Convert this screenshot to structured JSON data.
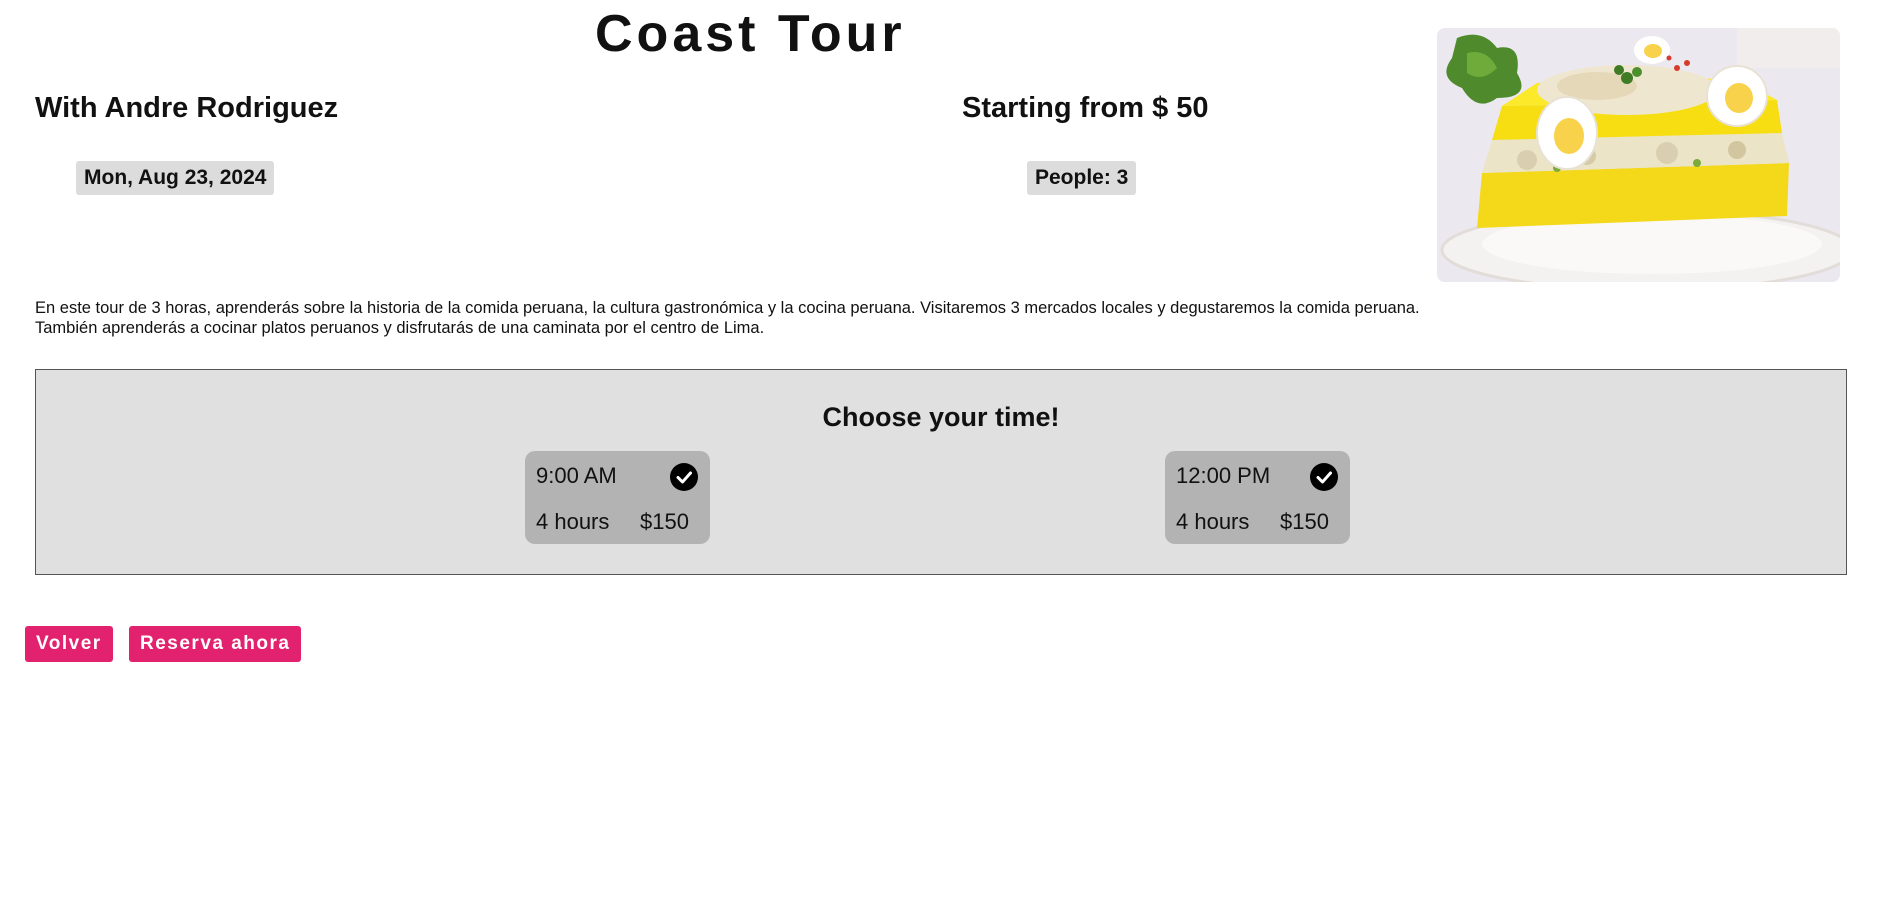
{
  "tour": {
    "title": "Coast Tour",
    "guide": "With Andre Rodriguez",
    "starting_price": "Starting from $ 50",
    "date": "Mon, Aug 23, 2024",
    "people": "People: 3",
    "description": "En este tour de 3 horas, aprenderás sobre la historia de la comida peruana, la cultura gastronómica y la cocina peruana. Visitaremos 3 mercados locales y degustaremos la comida peruana. También aprenderás a cocinar platos peruanos y disfrutarás de una caminata por el centro de Lima.",
    "image": {
      "alt": "causa-dish-photo"
    }
  },
  "time_picker": {
    "heading": "Choose your time!",
    "slots": [
      {
        "time": "9:00 AM",
        "duration": "4 hours",
        "price": "$150",
        "icon": "check-circle-icon"
      },
      {
        "time": "12:00 PM",
        "duration": "4 hours",
        "price": "$150",
        "icon": "check-circle-icon"
      }
    ]
  },
  "actions": {
    "back_label": "Volver",
    "book_label": "Reserva ahora"
  },
  "colors": {
    "accent": "#e3226f",
    "panel_bg": "#e0e0e0",
    "slot_bg": "#b3b3b3",
    "pill_bg": "#dcdcdc"
  }
}
